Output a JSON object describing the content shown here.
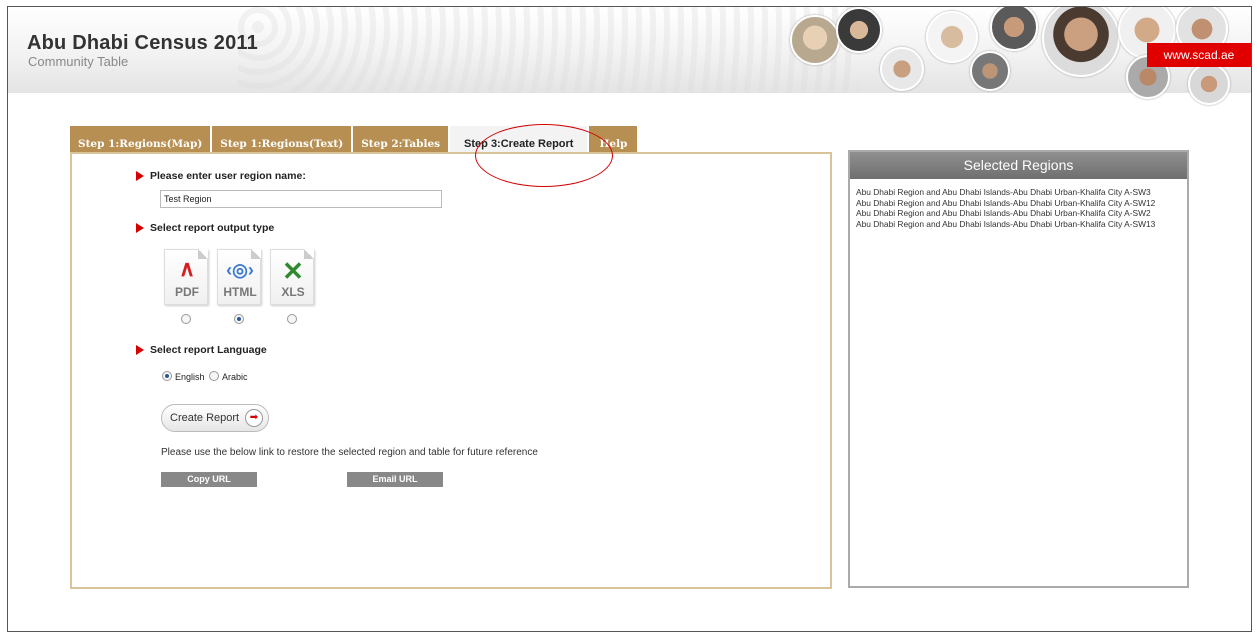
{
  "header": {
    "title": "Abu Dhabi Census 2011",
    "subtitle": "Community Table",
    "site_link": "www.scad.ae"
  },
  "tabs": [
    {
      "label": "Step 1:Regions(Map)",
      "active": false
    },
    {
      "label": "Step 1:Regions(Text)",
      "active": false
    },
    {
      "label": "Step 2:Tables",
      "active": false
    },
    {
      "label": "Step 3:Create Report",
      "active": true
    },
    {
      "label": "Help",
      "active": false
    }
  ],
  "report_form": {
    "region_name_label": "Please enter user region name:",
    "region_name_value": "Test Region",
    "output_type_label": "Select report output type",
    "output_types": [
      {
        "ext": "PDF",
        "icon": "pdf-icon",
        "color": "#d42020",
        "selected": false
      },
      {
        "ext": "HTML",
        "icon": "html-globe-icon",
        "color": "#3a7ad0",
        "selected": true
      },
      {
        "ext": "XLS",
        "icon": "excel-icon",
        "color": "#2f8a2f",
        "selected": false
      }
    ],
    "language_label": "Select report Language",
    "languages": [
      {
        "label": "English",
        "selected": true
      },
      {
        "label": "Arabic",
        "selected": false
      }
    ],
    "create_button_label": "Create Report",
    "restore_text": "Please use the below link to restore the selected region and table for future reference",
    "copy_url_label": "Copy URL",
    "email_url_label": "Email URL"
  },
  "selected_regions": {
    "title": "Selected Regions",
    "items": [
      "Abu Dhabi Region and Abu Dhabi Islands-Abu Dhabi Urban-Khalifa City A-SW3",
      "Abu Dhabi Region and Abu Dhabi Islands-Abu Dhabi Urban-Khalifa City A-SW12",
      "Abu Dhabi Region and Abu Dhabi Islands-Abu Dhabi Urban-Khalifa City A-SW2",
      "Abu Dhabi Region and Abu Dhabi Islands-Abu Dhabi Urban-Khalifa City A-SW13"
    ]
  },
  "colors": {
    "tab_bg": "#b88f52",
    "panel_border": "#d9c49a",
    "accent_red": "#d40000",
    "badge_red": "#e00000"
  }
}
